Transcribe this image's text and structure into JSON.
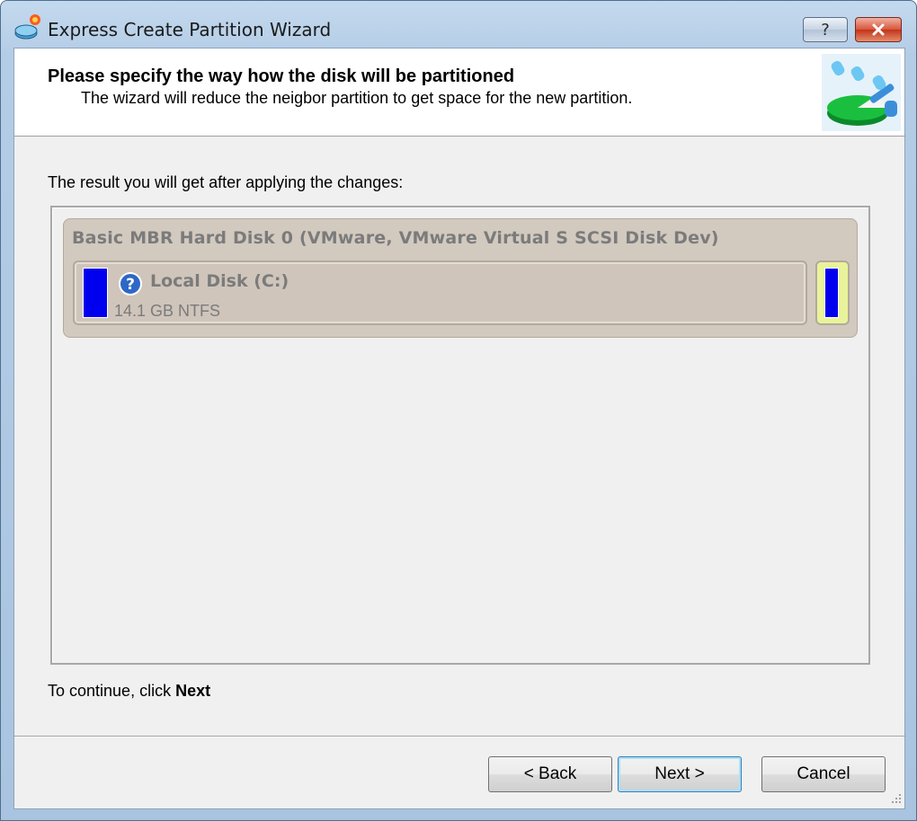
{
  "window": {
    "title": "Express Create Partition Wizard",
    "help_glyph": "?",
    "close_glyph": "✕"
  },
  "header": {
    "title": "Please specify the way how the disk will be partitioned",
    "subtitle": "The wizard will reduce the neigbor partition to get space for the new partition."
  },
  "result": {
    "label": "The result you will get after applying the changes:",
    "disk": {
      "title": "Basic MBR Hard Disk 0 (VMware, VMware Virtual S SCSI Disk Dev)",
      "partitions": [
        {
          "name": "Local Disk (C:)",
          "size": "14.1 GB NTFS",
          "status_icon": "question-icon"
        }
      ],
      "unallocated_icon": "unallocated-space"
    }
  },
  "footer": {
    "continue_prefix": "To continue, click ",
    "continue_strong": "Next"
  },
  "buttons": {
    "back": "< Back",
    "next": "Next >",
    "cancel": "Cancel"
  },
  "colors": {
    "usage_bar": "#0000ee",
    "unallocated": "#e9f39a",
    "disk_panel": "#d2c9bf"
  }
}
